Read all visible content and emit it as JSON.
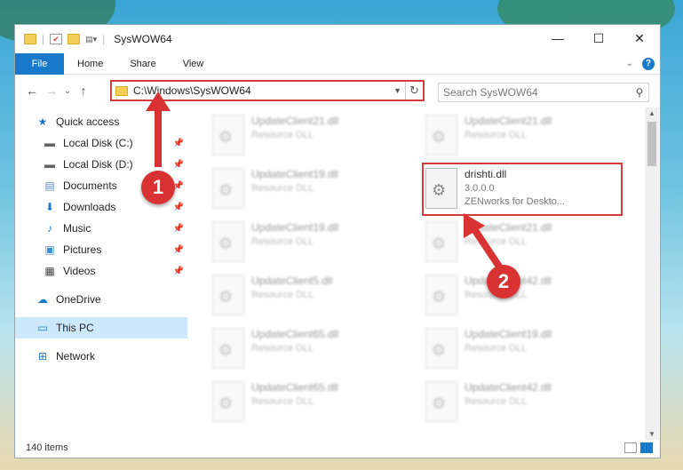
{
  "window": {
    "title": "SysWOW64",
    "minimize": "—",
    "maximize": "☐",
    "close": "✕"
  },
  "ribbon": {
    "tabs": [
      "File",
      "Home",
      "Share",
      "View"
    ]
  },
  "address": {
    "path": "C:\\Windows\\SysWOW64"
  },
  "search": {
    "placeholder": "Search SysWOW64"
  },
  "sidebar": {
    "quick_access": "Quick access",
    "items": [
      {
        "label": "Local Disk (C:)",
        "icon": "drive-icon"
      },
      {
        "label": "Local Disk (D:)",
        "icon": "drive-icon"
      },
      {
        "label": "Documents",
        "icon": "documents-icon"
      },
      {
        "label": "Downloads",
        "icon": "download-icon"
      },
      {
        "label": "Music",
        "icon": "music-icon"
      },
      {
        "label": "Pictures",
        "icon": "pictures-icon"
      },
      {
        "label": "Videos",
        "icon": "videos-icon"
      }
    ],
    "onedrive": "OneDrive",
    "thispc": "This PC",
    "network": "Network"
  },
  "files": [
    {
      "name": "UpdateClient21.dll",
      "desc": "Resource DLL"
    },
    {
      "name": "UpdateClient21.dll",
      "desc": "Resource DLL"
    },
    {
      "name": "UpdateClient19.dll",
      "desc": "Resource DLL"
    },
    {
      "name": "drishti.dll",
      "desc": "3.0.0.0",
      "desc2": "ZENworks for Deskto..."
    },
    {
      "name": "UpdateClient19.dll",
      "desc": "Resource DLL"
    },
    {
      "name": "UpdateClient21.dll",
      "desc": "Resource DLL"
    },
    {
      "name": "UpdateClient5.dll",
      "desc": "Resource DLL"
    },
    {
      "name": "UpdateClient42.dll",
      "desc": "Resource DLL"
    },
    {
      "name": "UpdateClient65.dll",
      "desc": "Resource DLL"
    },
    {
      "name": "UpdateClient19.dll",
      "desc": "Resource DLL"
    },
    {
      "name": "UpdateClient65.dll",
      "desc": "Resource DLL"
    },
    {
      "name": "UpdateClient42.dll",
      "desc": "Resource DLL"
    }
  ],
  "status": {
    "count": "140 items"
  },
  "callouts": {
    "one": "1",
    "two": "2"
  },
  "colors": {
    "accent": "#1979ca",
    "highlight": "#d43c3c"
  }
}
